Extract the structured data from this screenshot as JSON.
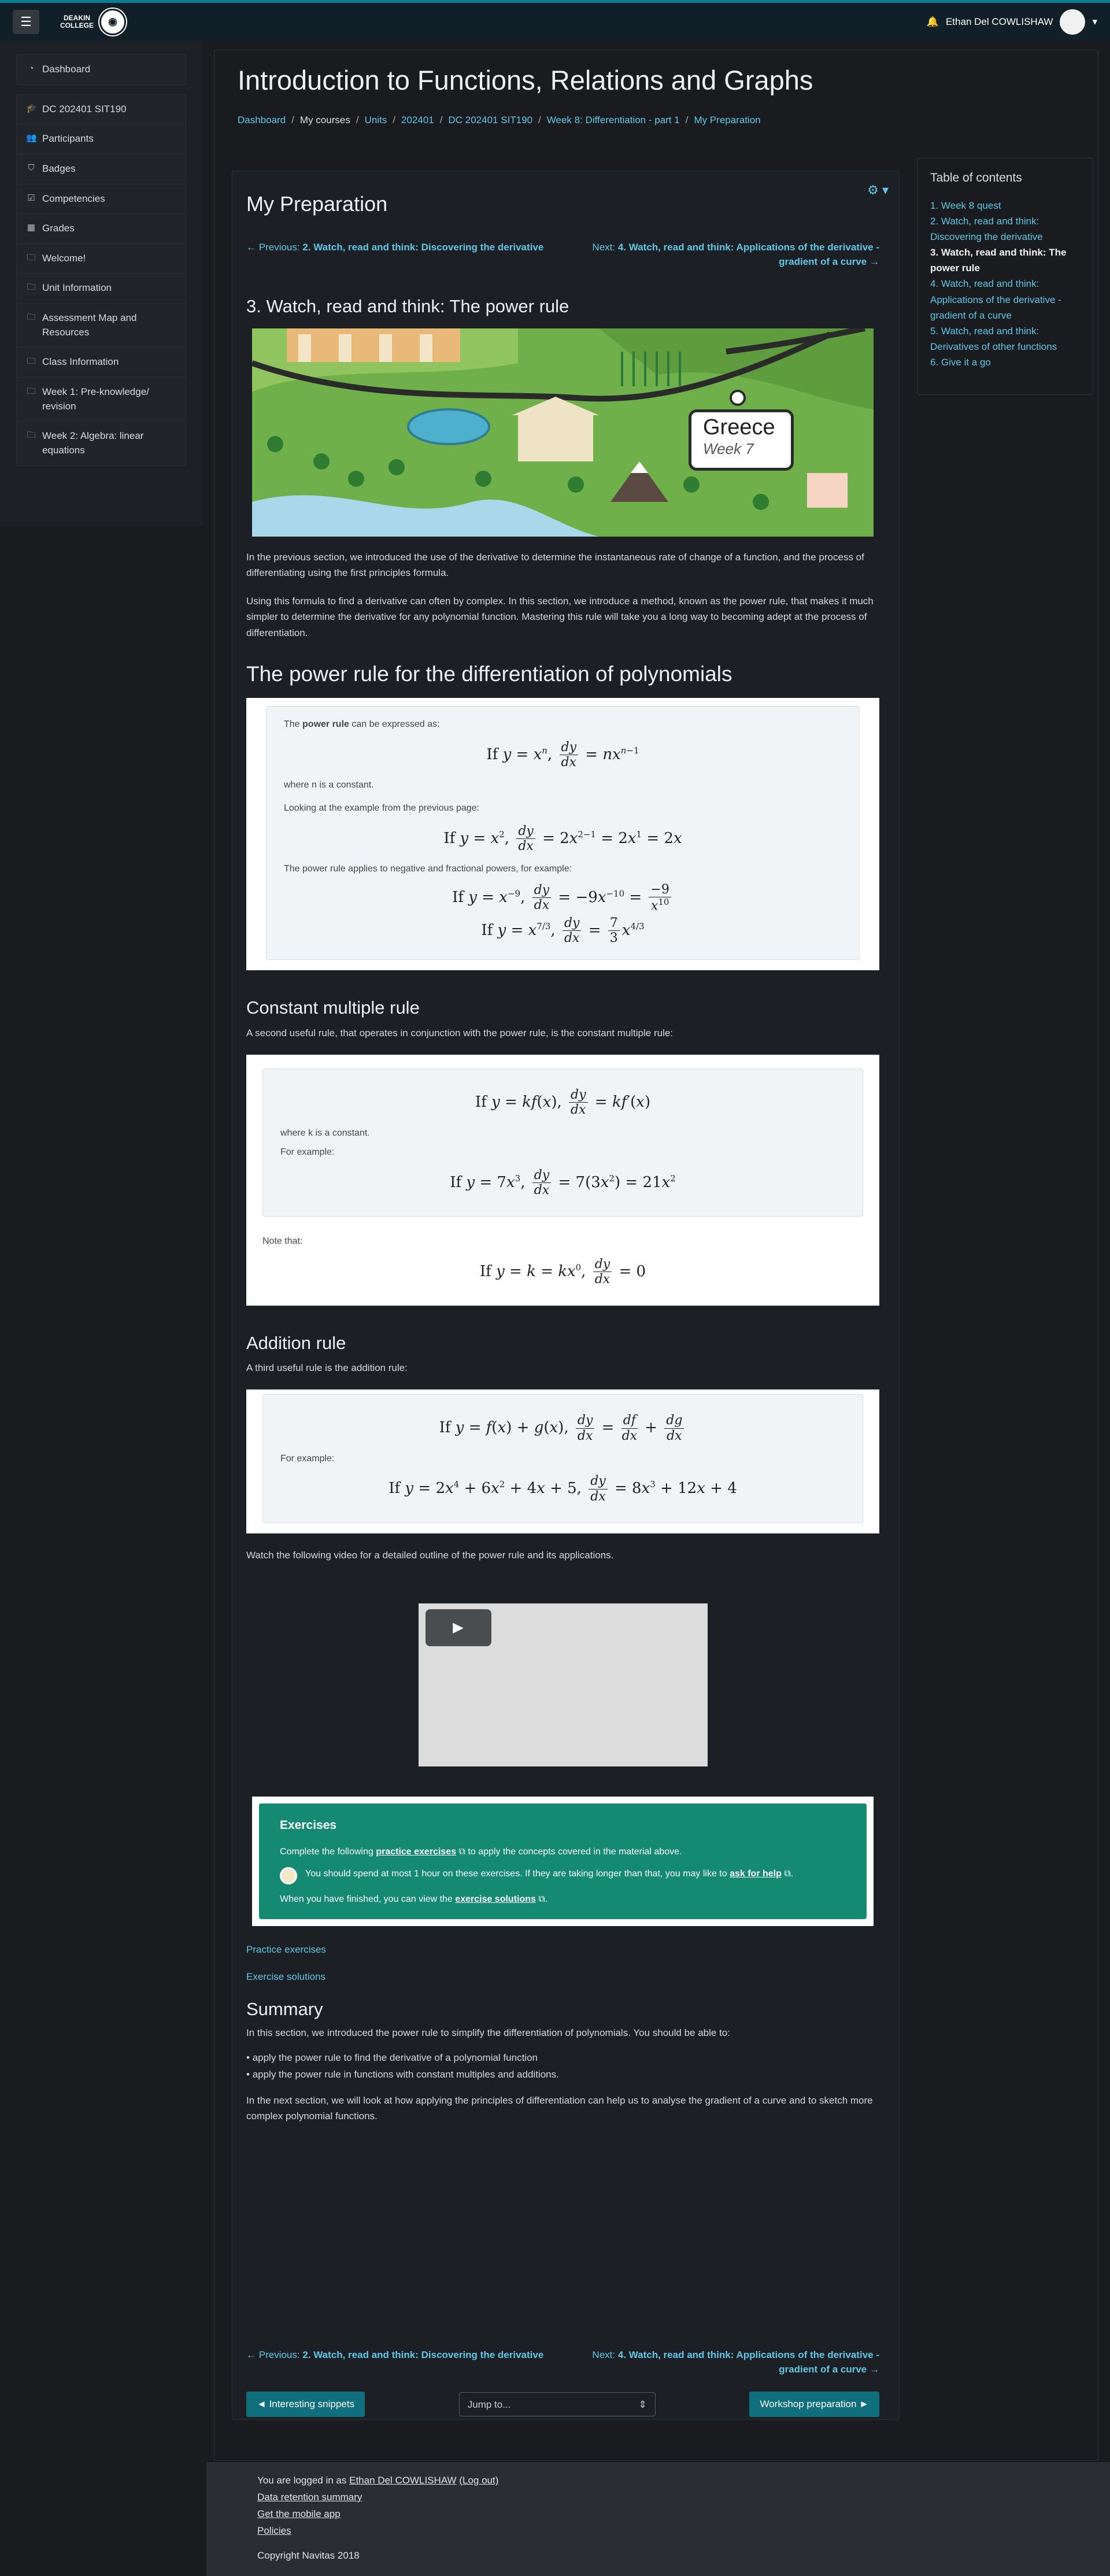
{
  "topbar": {
    "logo_line1": "DEAKIN",
    "logo_line2": "COLLEGE",
    "user_name": "Ethan Del COWLISHAW"
  },
  "sidebar": {
    "group1": [
      {
        "label": "Dashboard",
        "icon": "dashboard-icon"
      }
    ],
    "group2": [
      {
        "label": "DC 202401 SIT190",
        "icon": "graduation-cap-icon"
      },
      {
        "label": "Participants",
        "icon": "users-icon"
      },
      {
        "label": "Badges",
        "icon": "shield-icon"
      },
      {
        "label": "Competencies",
        "icon": "checkbox-icon"
      },
      {
        "label": "Grades",
        "icon": "table-icon"
      },
      {
        "label": "Welcome!",
        "icon": "folder-icon"
      },
      {
        "label": "Unit Information",
        "icon": "folder-icon"
      },
      {
        "label": "Assessment Map and Resources",
        "icon": "folder-icon"
      },
      {
        "label": "Class Information",
        "icon": "folder-icon"
      },
      {
        "label": "Week 1: Pre-knowledge/ revision",
        "icon": "folder-icon"
      },
      {
        "label": "Week 2: Algebra: linear equations",
        "icon": "folder-icon"
      }
    ]
  },
  "header": {
    "title": "Introduction to Functions, Relations and Graphs",
    "breadcrumbs": [
      "Dashboard",
      "My courses",
      "Units",
      "202401",
      "DC 202401 SIT190",
      "Week 8: Differentiation - part 1",
      "My Preparation"
    ]
  },
  "book": {
    "title": "My Preparation",
    "prev_prefix": "Previous:",
    "prev_label": "2. Watch, read and think: Discovering the derivative",
    "next_prefix": "Next:",
    "next_label": "4. Watch, read and think: Applications of the derivative - gradient of a curve",
    "chapter_title": "3. Watch, read and think: The power rule",
    "banner_title": "Greece",
    "banner_sub": "Week 7",
    "intro_p1": "In the previous section, we introduced the use of the derivative to determine the instantaneous rate of change of a function, and the process of differentiating using the first principles formula.",
    "intro_p2": "Using this formula to find a derivative can often by complex. In this section, we introduce a method, known as the power rule, that makes it much simpler to determine the derivative for any polynomial function. Mastering this rule will take you a long way to becoming adept at the process of differentiation.",
    "h_power": "The power rule for the differentiation of polynomials",
    "power_intro_a": "The ",
    "power_intro_b": "power rule",
    "power_intro_c": " can be expressed as:",
    "where_n": "where n is a constant.",
    "looking": "Looking at the example from the previous page:",
    "negative": "The power rule applies to negative and fractional powers, for example:",
    "h_constant": "Constant multiple rule",
    "constant_intro": "A second useful rule, that operates in conjunction with the power rule, is the constant multiple rule:",
    "where_k": "where k is a constant.",
    "for_example": "For example:",
    "note_that": "Note that:",
    "h_addition": "Addition rule",
    "addition_intro": "A third useful rule is the addition rule:",
    "for_example2": "For example:",
    "video_intro": "Watch the following video for a detailed outline of the power rule and its applications.",
    "ex_title": "Exercises",
    "ex_p1_a": "Complete the following ",
    "ex_p1_link": "practice exercises",
    "ex_p1_b": " to apply the concepts covered in the material above.",
    "ex_p2_a": "You should spend at most 1 hour on these exercises. If they are taking longer than that, you may like to ",
    "ex_p2_link": "ask for help",
    "ex_p3_a": "When you have finished, you can view the ",
    "ex_p3_link": "exercise solutions",
    "link_practice": "Practice exercises",
    "link_solutions": "Exercise solutions",
    "h_summary": "Summary",
    "summary_p1": "In this section, we introduced the power rule to simplify the differentiation of polynomials. You should be able to:",
    "summary_items": [
      "apply the power rule to find the derivative of a polynomial function",
      "apply the power rule in functions with constant multiples and additions."
    ],
    "summary_p2": "In the next section, we will look at how applying the principles of differentiation can help us to analyse the gradient of a curve and to sketch more complex polynomial functions.",
    "btn_prev": "Interesting snippets",
    "jump_placeholder": "Jump to...",
    "btn_next": "Workshop preparation"
  },
  "toc": {
    "title": "Table of contents",
    "items": [
      {
        "label": "1. Week 8 quest",
        "current": false
      },
      {
        "label": "2. Watch, read and think: Discovering the derivative",
        "current": false
      },
      {
        "label": "3. Watch, read and think: The power rule",
        "current": true
      },
      {
        "label": "4. Watch, read and think: Applications of the derivative - gradient of a curve",
        "current": false
      },
      {
        "label": "5. Watch, read and think: Derivatives of other functions",
        "current": false
      },
      {
        "label": "6. Give it a go",
        "current": false
      }
    ]
  },
  "footer": {
    "logged_a": "You are logged in as ",
    "logged_user": "Ethan Del COWLISHAW",
    "logout": "(Log out)",
    "links": [
      "Data retention summary",
      "Get the mobile app",
      "Policies"
    ],
    "copyright": "Copyright Navitas 2018"
  },
  "colors": {
    "accent": "#5ec8e6",
    "topbar": "#112028",
    "exercise_bg": "#158a72",
    "button": "#0f6f7d"
  }
}
